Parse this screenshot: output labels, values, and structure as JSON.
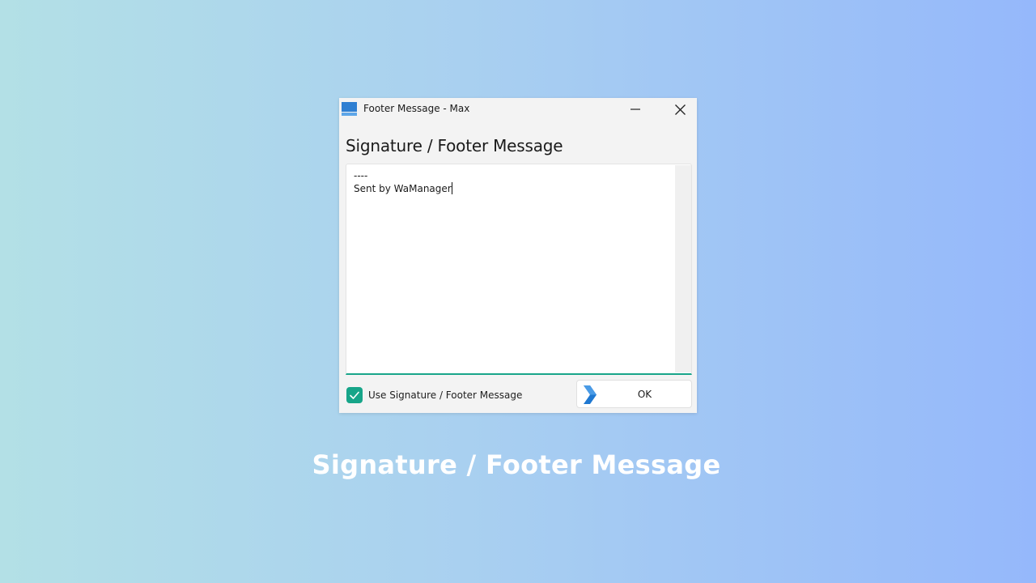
{
  "window": {
    "title": "Footer Message - Max",
    "heading": "Signature / Footer Message",
    "editor": {
      "line1": "----",
      "line2": "Sent by WaManager"
    },
    "checkbox": {
      "label": "Use Signature / Footer Message",
      "checked": true
    },
    "ok_button": {
      "label": "OK"
    }
  },
  "caption": "Signature / Footer Message",
  "colors": {
    "accent": "#17a589",
    "ok_arrow": "#1f78d1"
  }
}
